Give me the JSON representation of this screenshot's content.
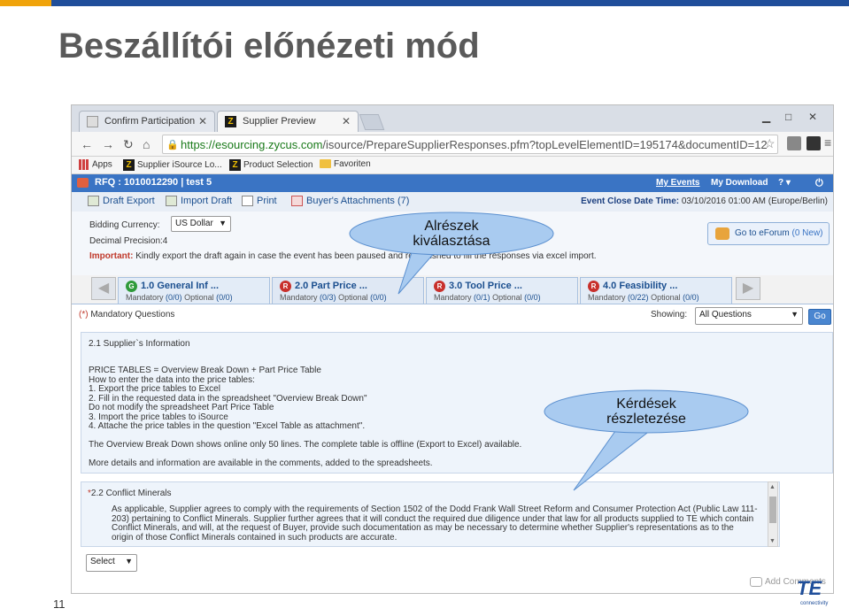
{
  "slide": {
    "title": "Beszállítói előnézeti mód",
    "page_number": "11"
  },
  "callouts": {
    "alreszek": "Alrészek kiválasztása",
    "kerdesek": "Kérdések részletezése"
  },
  "browser": {
    "tabs": [
      {
        "label": "Confirm Participation"
      },
      {
        "label": "Supplier Preview"
      }
    ],
    "url_host": "https://esourcing.zycus.com",
    "url_rest": "/isource/PrepareSupplierResponses.pfm?topLevelElementID=195174&documentID=12",
    "bookmarks": {
      "apps": "Apps",
      "supplier_isource": "Supplier iSource Lo...",
      "product_selection": "Product Selection",
      "favoriten": "Favoriten"
    }
  },
  "app": {
    "rfq_title": "RFQ : 1010012290 | test 5",
    "links": {
      "my_events": "My Events",
      "my_download": "My Download",
      "help": "?"
    },
    "toolbar": {
      "draft_export": "Draft Export",
      "import_draft": "Import Draft",
      "print": "Print",
      "buyers_attachments": "Buyer's Attachments (7)"
    },
    "event_close_label": "Event Close Date Time:",
    "event_close_value": "03/10/2016 01:00 AM",
    "event_close_tz": "(Europe/Berlin)",
    "bidding_currency_label": "Bidding Currency:",
    "bidding_currency_value": "US Dollar",
    "decimal_precision": "Decimal Precision:4",
    "important_label": "Important:",
    "important_text": "Kindly export the draft again in case the event has been paused and republished to fill the responses via excel import.",
    "eforum_label": "Go to eForum",
    "eforum_new": "(0 New)"
  },
  "sections": [
    {
      "badge": "G",
      "name": "1.0 General Inf ...",
      "mandatory": "Mandatory",
      "m_val": "(0/0)",
      "optional": "Optional",
      "o_val": "(0/0)"
    },
    {
      "badge": "R",
      "name": "2.0 Part Price ...",
      "mandatory": "Mandatory",
      "m_val": "(0/3)",
      "optional": "Optional",
      "o_val": "(0/0)"
    },
    {
      "badge": "R",
      "name": "3.0 Tool Price ...",
      "mandatory": "Mandatory",
      "m_val": "(0/1)",
      "optional": "Optional",
      "o_val": "(0/0)"
    },
    {
      "badge": "R",
      "name": "4.0 Feasibility ...",
      "mandatory": "Mandatory",
      "m_val": "(0/22)",
      "optional": "Optional",
      "o_val": "(0/0)"
    }
  ],
  "questions": {
    "mandatory_star": "(*)",
    "mandatory_label": "Mandatory Questions",
    "showing_label": "Showing:",
    "showing_value": "All Questions",
    "go": "Go",
    "q1_title": "2.1 Supplier`s Information",
    "q1_lines": "PRICE TABLES = Overview Break Down + Part Price Table\nHow to enter the data into the price tables:\n1. Export the price tables to Excel\n2. Fill in the requested data in the spreadsheet \"Overview Break Down\"\nDo not modify the spreadsheet Part Price Table\n3. Import the price tables to iSource\n4. Attache the price tables in the question \"Excel Table as attachment\".",
    "q1_overview": "The Overview Break Down shows online only 50 lines. The complete table is offline (Export to Excel) available.",
    "q1_more": "More details and information are available in the comments, added to the spreadsheets.",
    "q2_star": "*",
    "q2_title": "2.2 Conflict Minerals",
    "q2_body": "As applicable, Supplier agrees to comply with the requirements of Section 1502 of the Dodd Frank Wall Street Reform and Consumer Protection Act (Public Law 111-203) pertaining to Conflict Minerals. Supplier further agrees that it will conduct the required due diligence under that law for all products supplied to TE which contain Conflict Minerals, and will, at the request of Buyer, provide such documentation as may be necessary to determine whether Supplier's representations as to the origin of those Conflict Minerals contained in such products are accurate.",
    "select_label": "Select",
    "add_comments": "Add Comments"
  },
  "logo": {
    "te": "TE",
    "tagline": "connectivity"
  },
  "colors": {
    "brand_blue": "#1f4e9a",
    "accent_orange": "#f0a30a",
    "app_blue": "#3a74c4",
    "status_green": "#2e9a3a",
    "status_red": "#c8302c",
    "callout_fill": "#9ec3ea"
  },
  "icons": [
    "back-icon",
    "forward-icon",
    "reload-icon",
    "home-icon",
    "lock-icon",
    "star-icon",
    "zycus-z-icon",
    "folder-icon",
    "power-icon",
    "chevron-left-icon",
    "chevron-right-icon"
  ]
}
